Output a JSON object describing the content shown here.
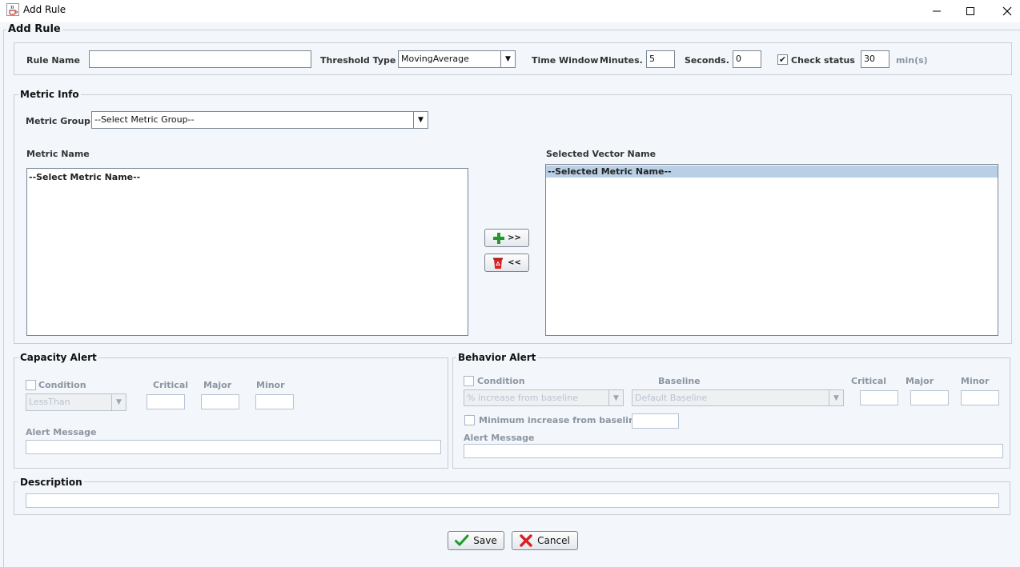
{
  "window": {
    "title": "Add Rule"
  },
  "dialog": {
    "title": "Add Rule"
  },
  "rule": {
    "rule_name_label": "Rule Name",
    "rule_name_value": "",
    "threshold_type_label": "Threshold Type",
    "threshold_type_value": "MovingAverage",
    "time_window_label": "Time Window",
    "minutes_label": "Minutes.",
    "minutes_value": "5",
    "seconds_label": "Seconds.",
    "seconds_value": "0",
    "check_status_label": "Check status",
    "check_status_checked": "✔",
    "interval_value": "30",
    "interval_unit": "min(s)"
  },
  "metric_info": {
    "title": "Metric Info",
    "metric_group_label": "Metric Group",
    "metric_group_value": "--Select Metric Group--",
    "metric_name_label": "Metric Name",
    "metric_name_items": [
      "--Select Metric Name--"
    ],
    "selected_vector_label": "Selected Vector Name",
    "selected_vector_items": [
      "--Selected Metric Name--"
    ],
    "add_button_label": ">>",
    "remove_button_label": "<<"
  },
  "capacity_alert": {
    "title": "Capacity Alert",
    "condition_label": "Condition",
    "condition_value": "LessThan",
    "critical_label": "Critical",
    "major_label": "Major",
    "minor_label": "Minor",
    "alert_message_label": "Alert Message"
  },
  "behavior_alert": {
    "title": "Behavior Alert",
    "condition_label": "Condition",
    "condition_value": "% increase from baseline",
    "baseline_label": "Baseline",
    "baseline_value": "Default Baseline",
    "critical_label": "Critical",
    "major_label": "Major",
    "minor_label": "Minor",
    "min_increase_label": "Minimum increase from baseline",
    "alert_message_label": "Alert Message"
  },
  "description": {
    "title": "Description"
  },
  "footer": {
    "save_label": "Save",
    "cancel_label": "Cancel"
  },
  "colors": {
    "background": "#f3f7fb",
    "selection": "#b8cfe5",
    "save_check": "#1e9a2e",
    "cancel_x": "#d92020",
    "add_plus": "#1e9a2e"
  },
  "icons": {
    "app": "java-cup-icon",
    "minimize": "minimize-icon",
    "maximize": "maximize-icon",
    "close": "close-icon",
    "add": "green-plus-icon",
    "remove": "red-bucket-icon",
    "save": "green-check-icon",
    "cancel": "red-x-icon"
  }
}
